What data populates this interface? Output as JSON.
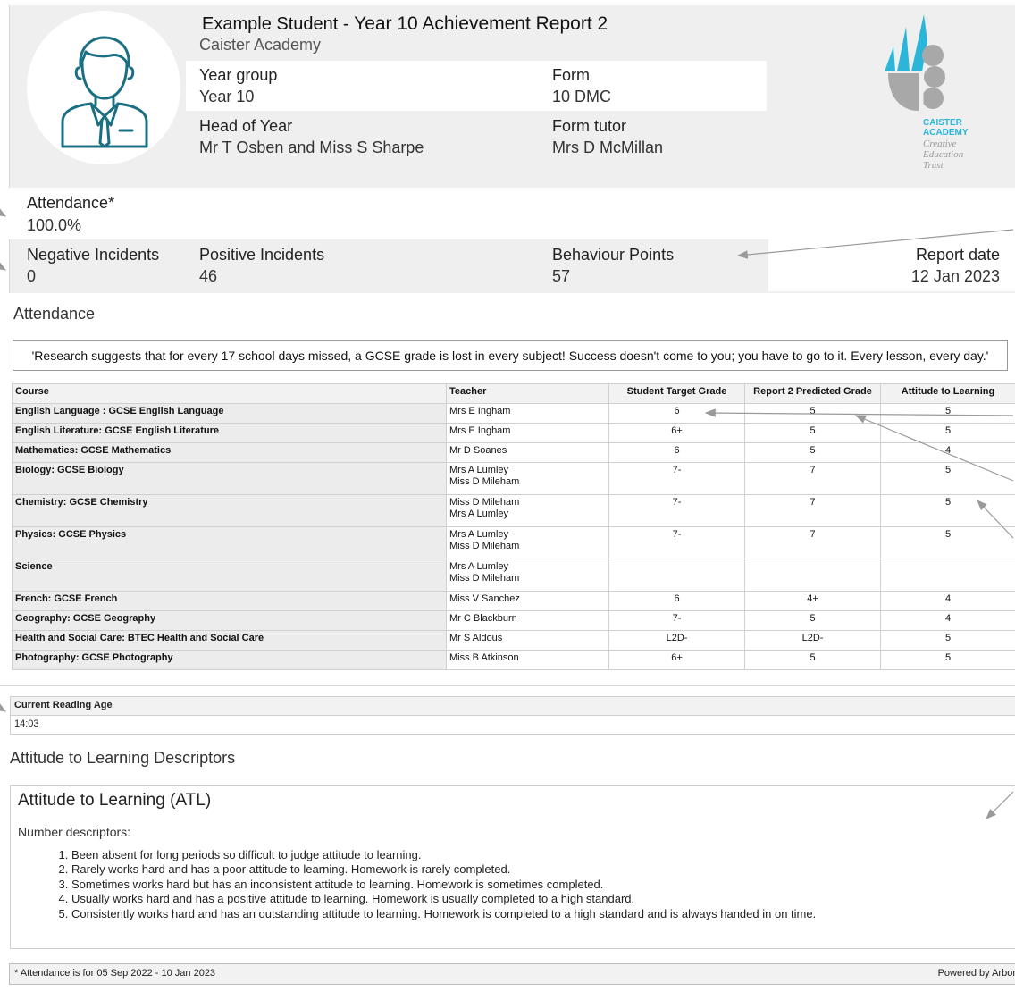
{
  "header": {
    "student_name": "Example Student",
    "separator": " - ",
    "report_title": "Year 10 Achievement Report 2",
    "school": "Caister Academy"
  },
  "info": {
    "year_group_label": "Year group",
    "year_group_value": "Year 10",
    "form_label": "Form",
    "form_value": "10 DMC",
    "head_of_year_label": "Head of Year",
    "head_of_year_value": "Mr T Osben and Miss S Sharpe",
    "form_tutor_label": "Form tutor",
    "form_tutor_value": "Mrs D McMillan"
  },
  "logo": {
    "line1": "CAISTER",
    "line2": "ACADEMY",
    "line3": "Creative",
    "line4": "Education",
    "line5": "Trust",
    "accent_color": "#2bb5d8"
  },
  "stats": {
    "attendance_label": "Attendance*",
    "attendance_value": "100.0%",
    "negative_label": "Negative Incidents",
    "negative_value": "0",
    "positive_label": "Positive Incidents",
    "positive_value": "46",
    "behaviour_label": "Behaviour Points",
    "behaviour_value": "57",
    "report_date_label": "Report date",
    "report_date_value": "12 Jan 2023"
  },
  "attendance_section": {
    "heading": "Attendance",
    "quote": "'Research suggests that for every 17 school days missed, a GCSE grade is lost in every subject! Success doesn't come to you; you have to go to it. Every lesson, every day.'"
  },
  "grades_table": {
    "headers": [
      "Course",
      "Teacher",
      "Student Target Grade",
      "Report 2 Predicted Grade",
      "Attitude to Learning"
    ],
    "rows": [
      {
        "course": "English Language : GCSE English Language",
        "teacher1": "Mrs E Ingham",
        "teacher2": "",
        "target": "6",
        "predicted": "5",
        "atl": "5"
      },
      {
        "course": "English Literature: GCSE English Literature",
        "teacher1": "Mrs E Ingham",
        "teacher2": "",
        "target": "6+",
        "predicted": "5",
        "atl": "5"
      },
      {
        "course": "Mathematics: GCSE Mathematics",
        "teacher1": "Mr D Soanes",
        "teacher2": "",
        "target": "6",
        "predicted": "5",
        "atl": "4"
      },
      {
        "course": "Biology: GCSE Biology",
        "teacher1": "Mrs A Lumley",
        "teacher2": "Miss D Mileham",
        "target": "7-",
        "predicted": "7",
        "atl": "5"
      },
      {
        "course": "Chemistry: GCSE Chemistry",
        "teacher1": "Miss D Mileham",
        "teacher2": "Mrs A Lumley",
        "target": "7-",
        "predicted": "7",
        "atl": "5"
      },
      {
        "course": "Physics: GCSE Physics",
        "teacher1": "Mrs A Lumley",
        "teacher2": "Miss D Mileham",
        "target": "7-",
        "predicted": "7",
        "atl": "5"
      },
      {
        "course": "Science",
        "teacher1": "Mrs A Lumley",
        "teacher2": "Miss D Mileham",
        "target": "",
        "predicted": "",
        "atl": ""
      },
      {
        "course": "French: GCSE French",
        "teacher1": "Miss V Sanchez",
        "teacher2": "",
        "target": "6",
        "predicted": "4+",
        "atl": "4"
      },
      {
        "course": "Geography: GCSE Geography",
        "teacher1": "Mr C Blackburn",
        "teacher2": "",
        "target": "7-",
        "predicted": "5",
        "atl": "4"
      },
      {
        "course": "Health and Social Care: BTEC Health and Social Care",
        "teacher1": "Mr S Aldous",
        "teacher2": "",
        "target": "L2D-",
        "predicted": "L2D-",
        "atl": "5"
      },
      {
        "course": "Photography: GCSE Photography",
        "teacher1": "Miss B Atkinson",
        "teacher2": "",
        "target": "6+",
        "predicted": "5",
        "atl": "5"
      }
    ]
  },
  "reading": {
    "label": "Current Reading Age",
    "value": "14:03"
  },
  "atl_section": {
    "heading": "Attitude to Learning Descriptors",
    "box_title": "Attitude to Learning (ATL)",
    "number_descriptors": "Number descriptors:",
    "items": [
      "Been absent for long periods so difficult to judge attitude to learning.",
      "Rarely works hard and has a poor attitude to learning.  Homework is rarely completed.",
      "Sometimes works hard but has an inconsistent attitude to learning.  Homework is sometimes completed.",
      "Usually works hard and has a positive attitude to learning.  Homework is usually completed to a high standard.",
      "Consistently works hard and has an outstanding attitude to learning.  Homework is completed to a high standard and is always handed in on time."
    ]
  },
  "footer": {
    "attendance_note": "* Attendance is for 05 Sep 2022 - 10 Jan 2023",
    "powered_by": "Powered by Arbor"
  },
  "icons": {
    "avatar": "student-avatar-icon",
    "logo": "caister-academy-logo-icon",
    "arrow": "annotation-arrow-icon"
  }
}
